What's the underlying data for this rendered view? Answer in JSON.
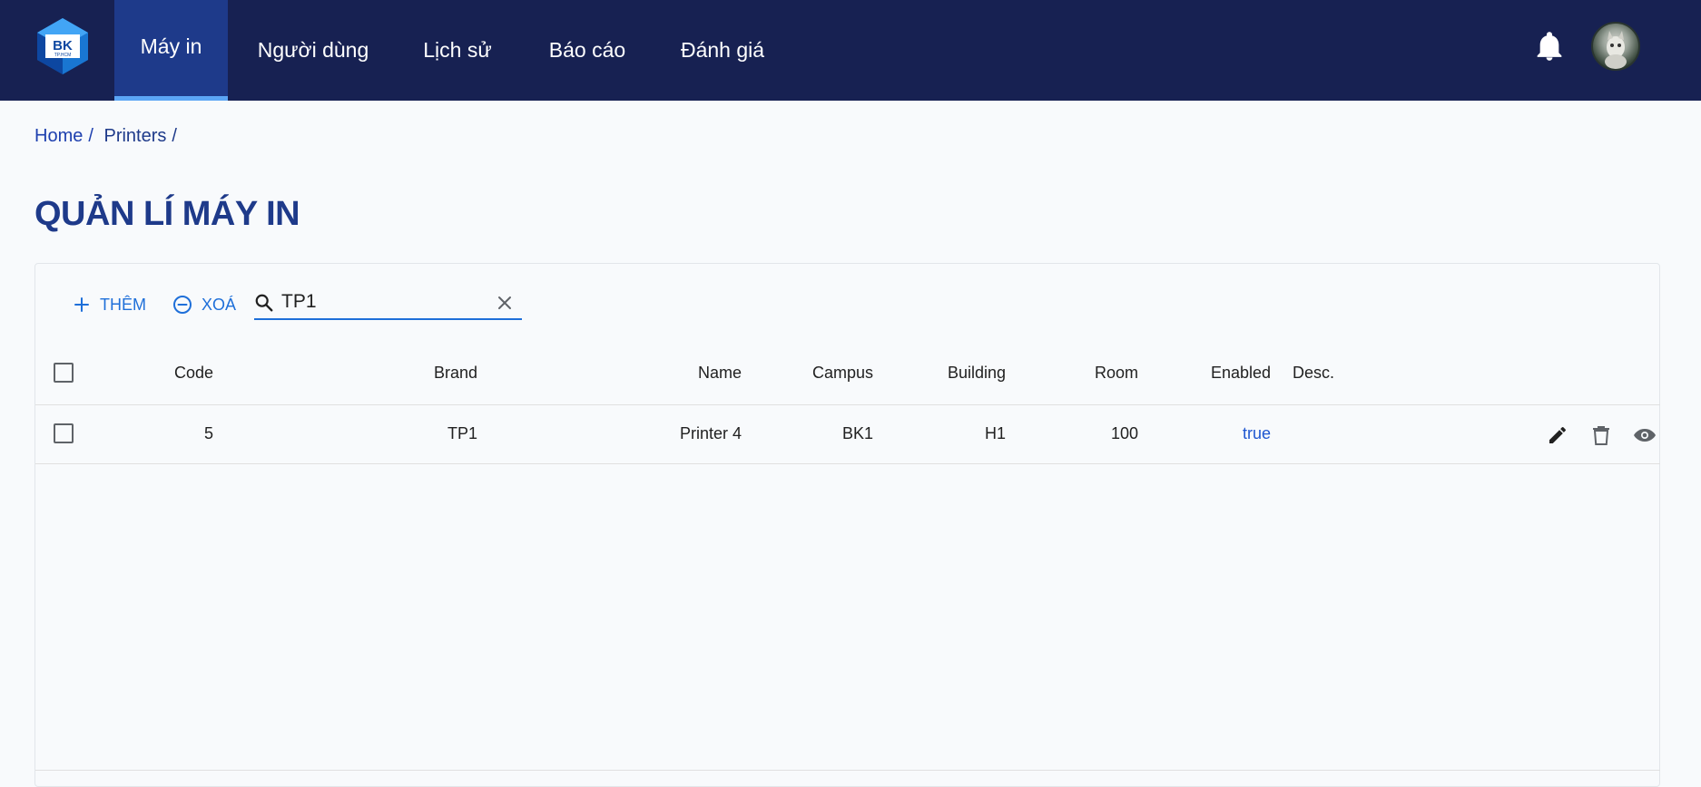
{
  "nav": {
    "logo_text": "BK",
    "logo_subtext": "TP.HCM",
    "items": [
      {
        "label": "Máy in",
        "active": true
      },
      {
        "label": "Người dùng",
        "active": false
      },
      {
        "label": "Lịch sử",
        "active": false
      },
      {
        "label": "Báo cáo",
        "active": false
      },
      {
        "label": "Đánh giá",
        "active": false
      }
    ],
    "icons": {
      "notifications": "bell-icon",
      "profile": "avatar"
    }
  },
  "breadcrumb": {
    "items": [
      "Home",
      "Printers"
    ],
    "separator": "/"
  },
  "page": {
    "title": "QUẢN LÍ MÁY IN"
  },
  "toolbar": {
    "add_label": "THÊM",
    "delete_label": "XOÁ",
    "search_value": "TP1",
    "search_placeholder": ""
  },
  "table": {
    "columns": [
      "Code",
      "Brand",
      "Name",
      "Campus",
      "Building",
      "Room",
      "Enabled",
      "Desc."
    ],
    "rows": [
      {
        "code": "5",
        "brand": "TP1",
        "name": "Printer 4",
        "campus": "BK1",
        "building": "H1",
        "room": "100",
        "enabled": "true",
        "desc": ""
      }
    ],
    "row_actions": [
      "edit-icon",
      "delete-icon",
      "view-icon"
    ]
  },
  "colors": {
    "nav_bg": "#172152",
    "nav_active_bg": "#1e3a8a",
    "nav_active_indicator": "#5ba5f5",
    "accent": "#1e6fd9",
    "title": "#1e3a8a",
    "enabled_true": "#1e56d0"
  }
}
